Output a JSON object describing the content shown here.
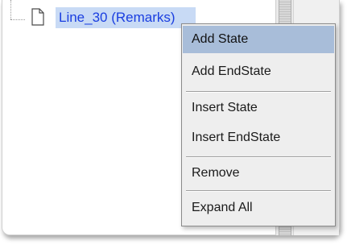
{
  "tree": {
    "node_label": "Line_30 (Remarks)",
    "node_icon": "document-icon"
  },
  "context_menu": {
    "items": [
      {
        "label": "Add State",
        "selected": true
      },
      {
        "label": "Add EndState",
        "selected": false
      },
      {
        "label": "Insert State",
        "selected": false
      },
      {
        "label": "Insert EndState",
        "selected": false
      },
      {
        "label": "Remove",
        "selected": false
      },
      {
        "label": "Expand All",
        "selected": false
      }
    ]
  },
  "colors": {
    "selection_highlight": "#a8bdd9",
    "node_text": "#1a3ee0",
    "node_highlight": "#c8daf5",
    "menu_background": "#eeeeee"
  }
}
